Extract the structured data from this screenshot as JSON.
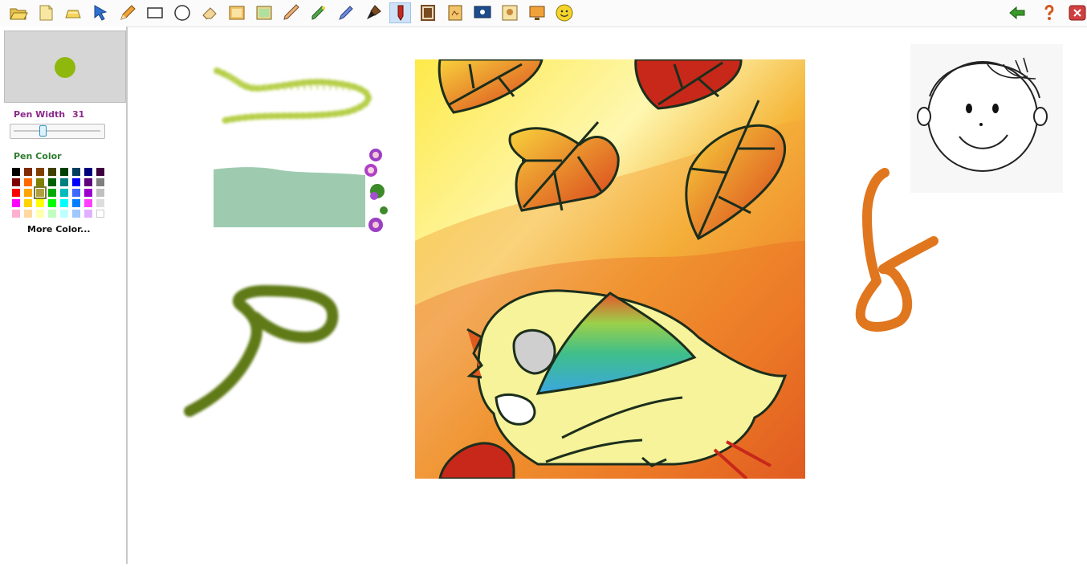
{
  "toolbar": {
    "left_tools": [
      {
        "name": "open-folder-icon",
        "active": false
      },
      {
        "name": "new-page-icon",
        "active": false
      },
      {
        "name": "clear-icon",
        "active": false
      },
      {
        "name": "select-arrow-icon",
        "active": false
      },
      {
        "name": "pencil-icon",
        "active": false
      },
      {
        "name": "rectangle-icon",
        "active": false
      },
      {
        "name": "ellipse-icon",
        "active": false
      },
      {
        "name": "eraser-icon",
        "active": false
      },
      {
        "name": "background-image-icon",
        "active": false
      },
      {
        "name": "picture-icon",
        "active": false
      },
      {
        "name": "crayon-icon",
        "active": false
      },
      {
        "name": "marker-icon",
        "active": false
      },
      {
        "name": "pen-icon",
        "active": false
      },
      {
        "name": "paint-brush-icon",
        "active": false
      },
      {
        "name": "stamp-pen-icon",
        "active": true
      },
      {
        "name": "frame-icon",
        "active": false
      },
      {
        "name": "sticker-icon",
        "active": false
      },
      {
        "name": "screen-icon",
        "active": false
      },
      {
        "name": "photo-icon",
        "active": false
      },
      {
        "name": "monitor-icon",
        "active": false
      },
      {
        "name": "smiley-icon",
        "active": false
      }
    ],
    "right_tools": [
      "undo-arrow-icon",
      "help-icon",
      "close-icon"
    ]
  },
  "panel": {
    "pen_width_label": "Pen Width",
    "pen_width_value": "31",
    "pen_width_fraction": 0.31,
    "pen_color_label": "Pen Color",
    "more_color_label": "More Color...",
    "current_color": "#8fb80f",
    "selected_swatch": 18,
    "palette": [
      "#000000",
      "#7f2a00",
      "#7f3f00",
      "#3f3f00",
      "#004000",
      "#003f5f",
      "#00007f",
      "#3f003f",
      "#7f0000",
      "#ff6a00",
      "#7f7f00",
      "#005f00",
      "#007f7f",
      "#0000ff",
      "#5f007f",
      "#7f7f7f",
      "#ff0000",
      "#ffa500",
      "#b0a040",
      "#00aa00",
      "#00bcbc",
      "#3f6aff",
      "#9b00cf",
      "#c0c0c0",
      "#ff00ff",
      "#ffd400",
      "#ffff00",
      "#00ff00",
      "#00ffff",
      "#0080ff",
      "#ff40ff",
      "#dddddd",
      "#ffb0d0",
      "#ffd9a0",
      "#ffffb0",
      "#c0ffc0",
      "#c0ffff",
      "#a0c8ff",
      "#e0b0ff",
      "#ffffff"
    ]
  },
  "colors": {
    "yellow_green_stroke": "#b6cf4a",
    "mint_rectangle": "#9ecbb0",
    "olive_stroke": "#5e7a14",
    "orange_stroke": "#e0761e",
    "toolbar_active": "#cfe3f7"
  }
}
